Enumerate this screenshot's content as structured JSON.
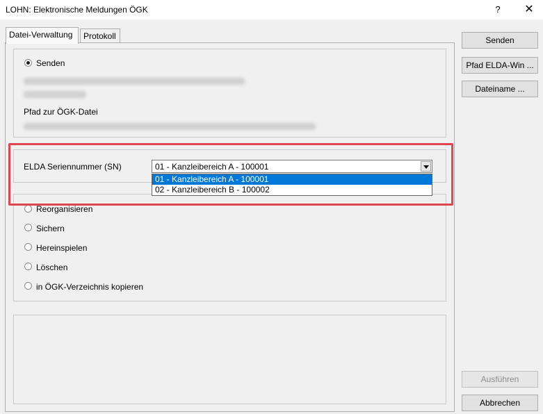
{
  "window": {
    "title": "LOHN: Elektronische Meldungen ÖGK",
    "help": "?",
    "close": "✕"
  },
  "tabs": [
    {
      "label": "Datei-Verwaltung"
    },
    {
      "label": "Protokoll"
    }
  ],
  "send_group": {
    "radio_label": "Senden",
    "path_label": "Pfad zur ÖGK-Datei"
  },
  "elda": {
    "label": "ELDA Seriennummer (SN)",
    "selected": "01 - Kanzleibereich A - 100001",
    "options": [
      "01 - Kanzleibereich A - 100001",
      "02 - Kanzleibereich B - 100002"
    ]
  },
  "options": [
    {
      "label": "Reorganisieren"
    },
    {
      "label": "Sichern"
    },
    {
      "label": "Hereinspielen"
    },
    {
      "label": "Löschen"
    },
    {
      "label": "in ÖGK-Verzeichnis kopieren"
    }
  ],
  "buttons": {
    "senden": "Senden",
    "pfad_elda": "Pfad ELDA-Win ...",
    "dateiname": "Dateiname ...",
    "ausfuehren": "Ausführen",
    "abbrechen": "Abbrechen"
  },
  "colors": {
    "highlight": "#e0464e",
    "selection": "#0078d7"
  }
}
